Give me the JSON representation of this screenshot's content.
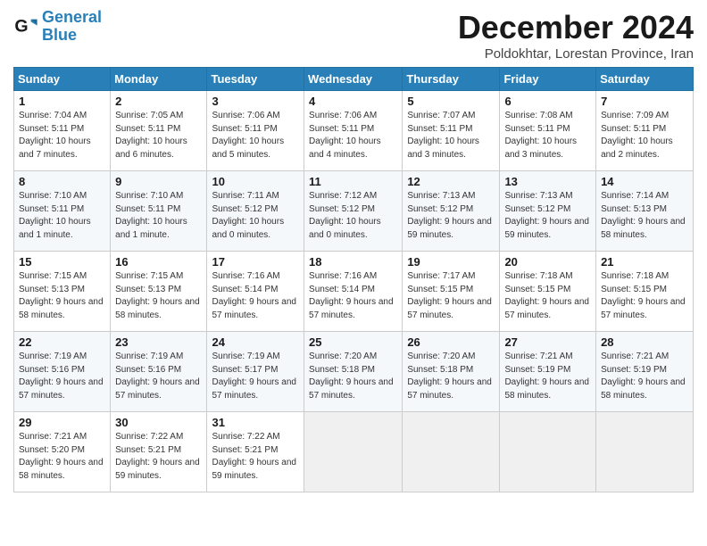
{
  "logo": {
    "line1": "General",
    "line2": "Blue"
  },
  "title": "December 2024",
  "location": "Poldokhtar, Lorestan Province, Iran",
  "days_of_week": [
    "Sunday",
    "Monday",
    "Tuesday",
    "Wednesday",
    "Thursday",
    "Friday",
    "Saturday"
  ],
  "weeks": [
    [
      {
        "day": "1",
        "sunrise": "7:04 AM",
        "sunset": "5:11 PM",
        "daylight": "10 hours and 7 minutes."
      },
      {
        "day": "2",
        "sunrise": "7:05 AM",
        "sunset": "5:11 PM",
        "daylight": "10 hours and 6 minutes."
      },
      {
        "day": "3",
        "sunrise": "7:06 AM",
        "sunset": "5:11 PM",
        "daylight": "10 hours and 5 minutes."
      },
      {
        "day": "4",
        "sunrise": "7:06 AM",
        "sunset": "5:11 PM",
        "daylight": "10 hours and 4 minutes."
      },
      {
        "day": "5",
        "sunrise": "7:07 AM",
        "sunset": "5:11 PM",
        "daylight": "10 hours and 3 minutes."
      },
      {
        "day": "6",
        "sunrise": "7:08 AM",
        "sunset": "5:11 PM",
        "daylight": "10 hours and 3 minutes."
      },
      {
        "day": "7",
        "sunrise": "7:09 AM",
        "sunset": "5:11 PM",
        "daylight": "10 hours and 2 minutes."
      }
    ],
    [
      {
        "day": "8",
        "sunrise": "7:10 AM",
        "sunset": "5:11 PM",
        "daylight": "10 hours and 1 minute."
      },
      {
        "day": "9",
        "sunrise": "7:10 AM",
        "sunset": "5:11 PM",
        "daylight": "10 hours and 1 minute."
      },
      {
        "day": "10",
        "sunrise": "7:11 AM",
        "sunset": "5:12 PM",
        "daylight": "10 hours and 0 minutes."
      },
      {
        "day": "11",
        "sunrise": "7:12 AM",
        "sunset": "5:12 PM",
        "daylight": "10 hours and 0 minutes."
      },
      {
        "day": "12",
        "sunrise": "7:13 AM",
        "sunset": "5:12 PM",
        "daylight": "9 hours and 59 minutes."
      },
      {
        "day": "13",
        "sunrise": "7:13 AM",
        "sunset": "5:12 PM",
        "daylight": "9 hours and 59 minutes."
      },
      {
        "day": "14",
        "sunrise": "7:14 AM",
        "sunset": "5:13 PM",
        "daylight": "9 hours and 58 minutes."
      }
    ],
    [
      {
        "day": "15",
        "sunrise": "7:15 AM",
        "sunset": "5:13 PM",
        "daylight": "9 hours and 58 minutes."
      },
      {
        "day": "16",
        "sunrise": "7:15 AM",
        "sunset": "5:13 PM",
        "daylight": "9 hours and 58 minutes."
      },
      {
        "day": "17",
        "sunrise": "7:16 AM",
        "sunset": "5:14 PM",
        "daylight": "9 hours and 57 minutes."
      },
      {
        "day": "18",
        "sunrise": "7:16 AM",
        "sunset": "5:14 PM",
        "daylight": "9 hours and 57 minutes."
      },
      {
        "day": "19",
        "sunrise": "7:17 AM",
        "sunset": "5:15 PM",
        "daylight": "9 hours and 57 minutes."
      },
      {
        "day": "20",
        "sunrise": "7:18 AM",
        "sunset": "5:15 PM",
        "daylight": "9 hours and 57 minutes."
      },
      {
        "day": "21",
        "sunrise": "7:18 AM",
        "sunset": "5:15 PM",
        "daylight": "9 hours and 57 minutes."
      }
    ],
    [
      {
        "day": "22",
        "sunrise": "7:19 AM",
        "sunset": "5:16 PM",
        "daylight": "9 hours and 57 minutes."
      },
      {
        "day": "23",
        "sunrise": "7:19 AM",
        "sunset": "5:16 PM",
        "daylight": "9 hours and 57 minutes."
      },
      {
        "day": "24",
        "sunrise": "7:19 AM",
        "sunset": "5:17 PM",
        "daylight": "9 hours and 57 minutes."
      },
      {
        "day": "25",
        "sunrise": "7:20 AM",
        "sunset": "5:18 PM",
        "daylight": "9 hours and 57 minutes."
      },
      {
        "day": "26",
        "sunrise": "7:20 AM",
        "sunset": "5:18 PM",
        "daylight": "9 hours and 57 minutes."
      },
      {
        "day": "27",
        "sunrise": "7:21 AM",
        "sunset": "5:19 PM",
        "daylight": "9 hours and 58 minutes."
      },
      {
        "day": "28",
        "sunrise": "7:21 AM",
        "sunset": "5:19 PM",
        "daylight": "9 hours and 58 minutes."
      }
    ],
    [
      {
        "day": "29",
        "sunrise": "7:21 AM",
        "sunset": "5:20 PM",
        "daylight": "9 hours and 58 minutes."
      },
      {
        "day": "30",
        "sunrise": "7:22 AM",
        "sunset": "5:21 PM",
        "daylight": "9 hours and 59 minutes."
      },
      {
        "day": "31",
        "sunrise": "7:22 AM",
        "sunset": "5:21 PM",
        "daylight": "9 hours and 59 minutes."
      },
      null,
      null,
      null,
      null
    ]
  ]
}
